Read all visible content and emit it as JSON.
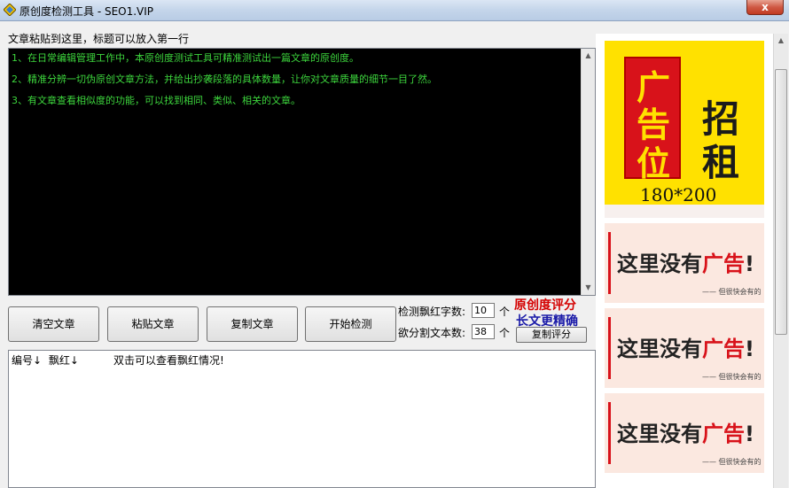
{
  "window": {
    "title": "原创度检测工具 - SEO1.VIP",
    "close_label": "x"
  },
  "editor": {
    "paste_label": "文章粘贴到这里，标题可以放入第一行",
    "lines": [
      "1、在日常编辑管理工作中，本原创度测试工具可精准测试出一篇文章的原创度。",
      "2、精准分辨一切伪原创文章方法，并给出抄袭段落的具体数量，让你对文章质量的细节一目了然。",
      "3、有文章查看相似度的功能，可以找到相同、类似、相关的文章。"
    ],
    "text_color": "#3dd63d"
  },
  "buttons": {
    "clear": "清空文章",
    "paste": "粘贴文章",
    "copy": "复制文章",
    "start": "开始检测"
  },
  "settings": {
    "red_count_label": "检测飘红字数:",
    "red_count_value": "10",
    "red_count_unit": "个",
    "split_label": "欲分割文本数:",
    "split_value": "38",
    "split_unit": "个"
  },
  "score": {
    "line1": "原创度评分",
    "line2": "长文更精确",
    "copy_label": "复制评分"
  },
  "results": {
    "col_id": "编号↓",
    "col_red": "飘红↓",
    "hint": "双击可以查看飘红情况!"
  },
  "ads": {
    "main_chars_left": [
      "广",
      "告",
      "位"
    ],
    "main_chars_right": [
      "招",
      "租"
    ],
    "main_size": "180*200",
    "small_text": "这里没有",
    "small_highlight": "广告",
    "small_mark": "!",
    "small_footer": "—— 但很快会有的",
    "colors": {
      "red": "#d8121a",
      "yellow": "#ffe100"
    }
  }
}
